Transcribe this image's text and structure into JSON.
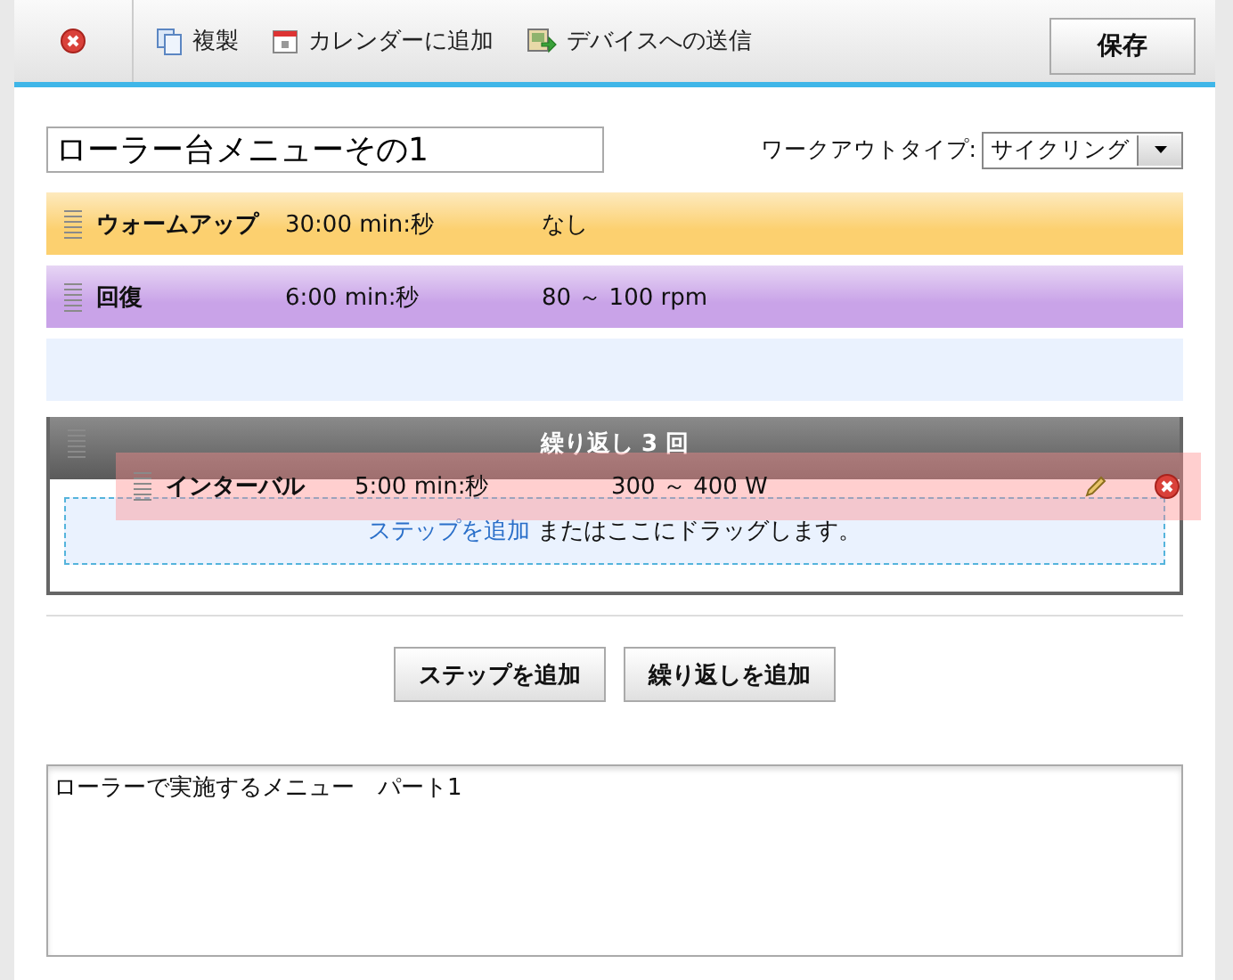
{
  "toolbar": {
    "items": [
      {
        "label": "複製"
      },
      {
        "label": "カレンダーに追加"
      },
      {
        "label": "デバイスへの送信"
      }
    ],
    "save_button": "保存"
  },
  "workout_name": "ローラー台メニューその1",
  "workout_type": {
    "label": "ワークアウトタイプ:",
    "value": "サイクリング"
  },
  "steps": [
    {
      "kind": "step",
      "name": "ウォームアップ",
      "duration": "30:00 min:秒",
      "target": "なし",
      "color": "#fcd06f"
    },
    {
      "kind": "step",
      "name": "回復",
      "duration": "6:00 min:秒",
      "target": "80 ～ 100 rpm",
      "color": "#c9a3e8"
    },
    {
      "kind": "dropzone"
    },
    {
      "kind": "repeat",
      "title": "繰り返し 3 回",
      "hint_link": "ステップを追加",
      "hint_text": "またはここにドラッグします。"
    }
  ],
  "dragged_step": {
    "name": "インターバル",
    "duration": "5:00 min:秒",
    "target": "300 ～ 400 W"
  },
  "buttons": [
    "ステップを追加",
    "繰り返しを追加"
  ],
  "notes": "ローラーで実施するメニュー　パート1"
}
